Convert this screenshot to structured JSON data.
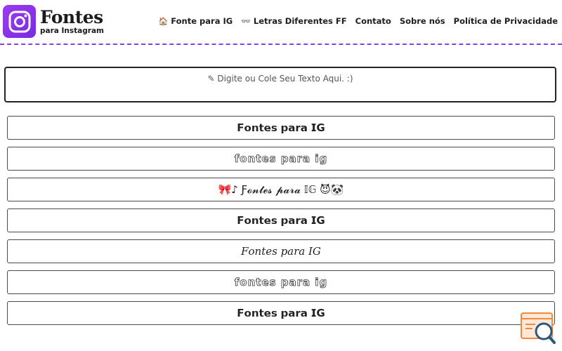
{
  "brand": {
    "title": "Fontes",
    "subtitle": "para Instagram"
  },
  "nav": [
    {
      "icon": "🏠",
      "label": "Fonte para IG"
    },
    {
      "icon": "👓",
      "label": "Letras Diferentes FF"
    },
    {
      "icon": "",
      "label": "Contato"
    },
    {
      "icon": "",
      "label": "Sobre nós"
    },
    {
      "icon": "",
      "label": "Política de Privacidade"
    }
  ],
  "input": {
    "placeholder": "✎ Digite ou Cole Seu Texto Aqui. :)"
  },
  "results": [
    "𝗙𝗼𝗻𝘁𝗲𝘀 𝗽𝗮𝗿𝗮 𝗜𝗚",
    "fontes para ig",
    "🎀♪ Ƒ𝓸𝓷𝓽𝓮𝓼 𝓹𝓪𝓻𝓪 𝕀𝔾 😈🐼",
    "𝗙𝗼𝗻𝘁𝗲𝘀 𝗽𝗮𝗿𝗮 𝗜𝗚",
    "F𝑜𝑛𝑡e𝑠 𝑝𝑎𝑟𝑎 I𝐺",
    "fontes para ig",
    "𝗙𝗼𝗻𝘁𝗲𝘀 𝗽𝗮𝗿𝗮 𝗜𝗚"
  ],
  "colors": {
    "accent": "#8a3df0",
    "logo_bg": "#9b3cf0",
    "widget": "#f08a3c"
  }
}
